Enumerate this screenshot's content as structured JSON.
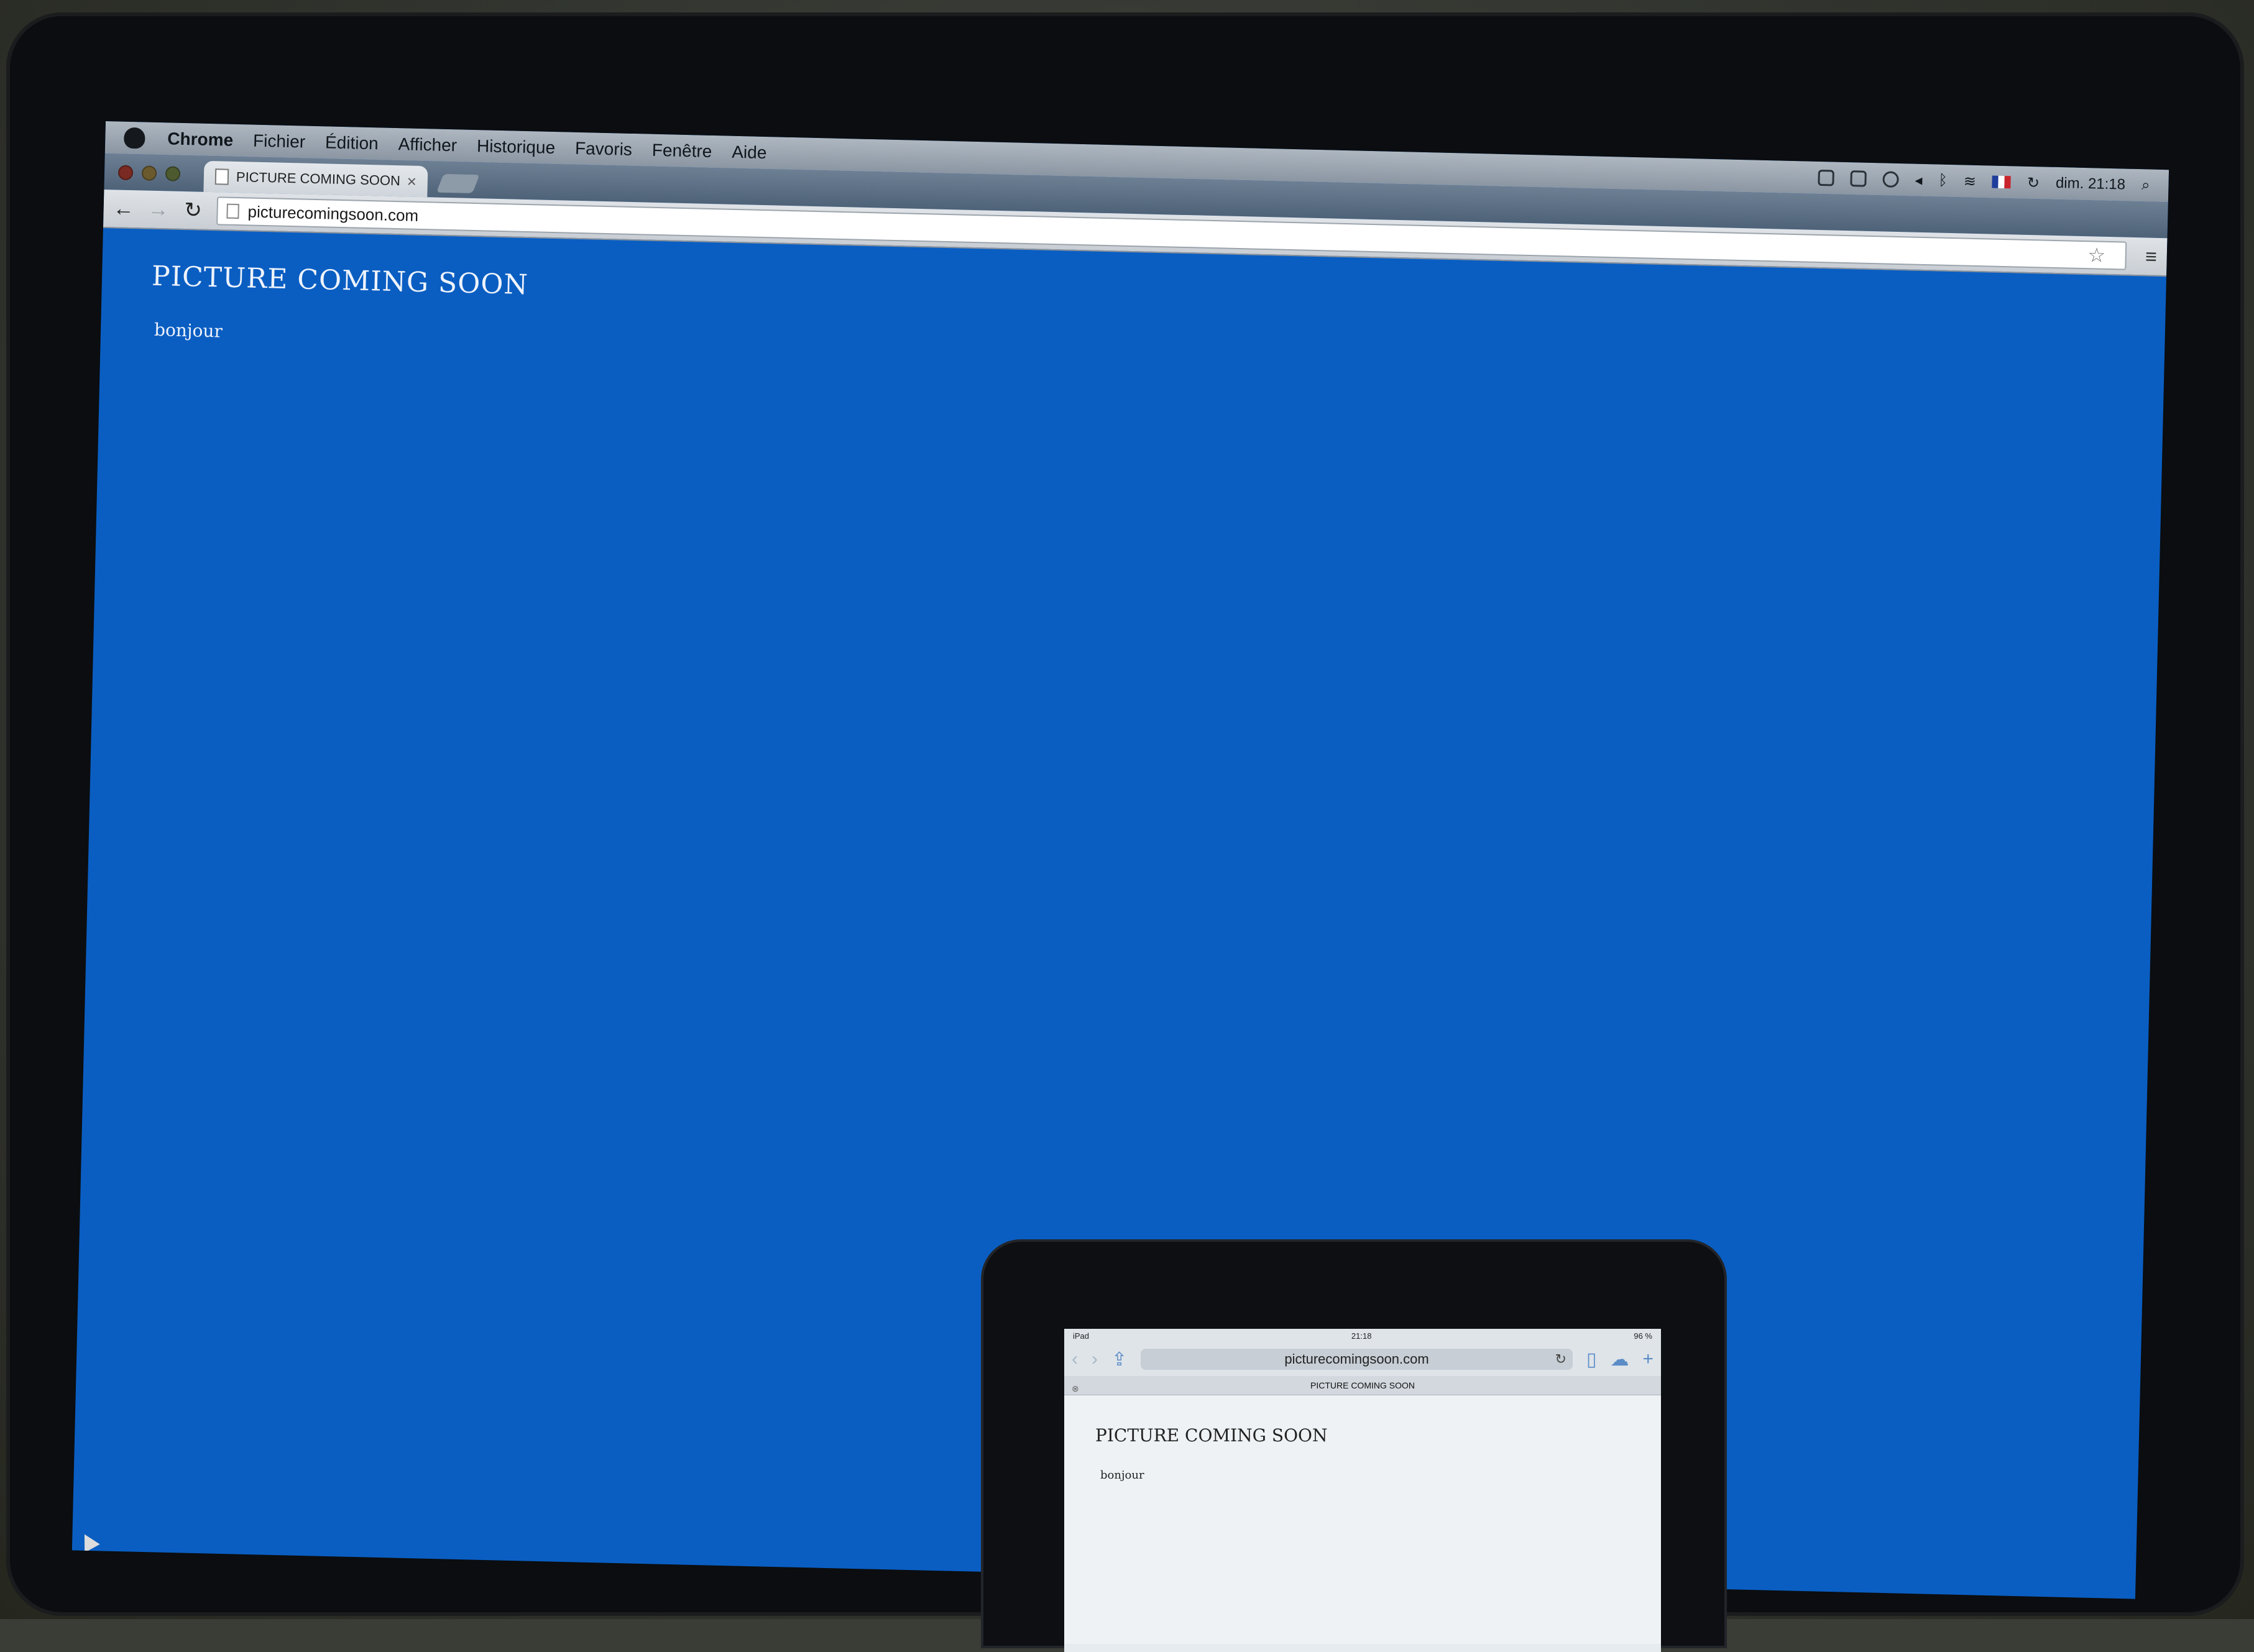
{
  "macos": {
    "menu": {
      "app": "Chrome",
      "items": [
        "Fichier",
        "Édition",
        "Afficher",
        "Historique",
        "Favoris",
        "Fenêtre",
        "Aide"
      ],
      "clock": "dim. 21:18"
    }
  },
  "browser": {
    "tab_title": "PICTURE COMING SOON",
    "tab_close": "×",
    "url": "picturecomingsoon.com"
  },
  "page": {
    "title": "PICTURE COMING SOON",
    "text": "bonjour"
  },
  "ipad": {
    "status": {
      "device": "iPad",
      "time": "21:18",
      "battery": "96 %"
    },
    "url": "picturecomingsoon.com",
    "tab_title": "PICTURE COMING SOON",
    "page_title": "PICTURE COMING SOON",
    "page_text": "bonjour"
  },
  "colors": {
    "desktop_page_bg": "#0a5ec2",
    "ipad_page_bg": "#eef2f5"
  }
}
